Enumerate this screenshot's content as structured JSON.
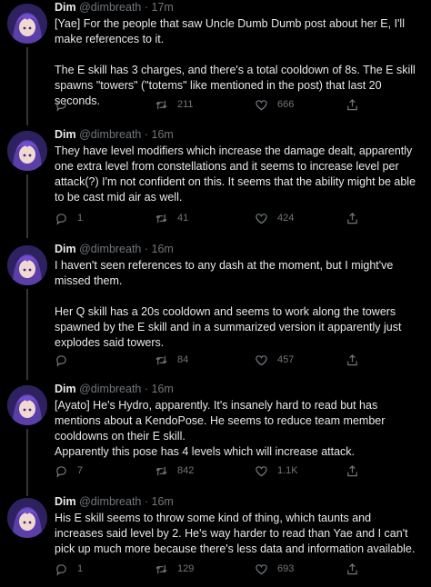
{
  "colors": {
    "background": "#000000",
    "text": "#e7e9ea",
    "muted": "#71767b",
    "line": "#333639"
  },
  "tweets": [
    {
      "name": "Dim",
      "handle": "@dimbreath",
      "dot": "·",
      "time": "17m",
      "text": "[Yae] For the people that saw Uncle Dumb Dumb post about her E, I'll make references to it.\n\nThe E skill has 3 charges, and there's a total cooldown of 8s. The E skill spawns \"towers\" (\"totems\" like mentioned in the post) that last 20 seconds.",
      "replies": "",
      "retweets": "211",
      "likes": "666"
    },
    {
      "name": "Dim",
      "handle": "@dimbreath",
      "dot": "·",
      "time": "16m",
      "text": "They have level modifiers which increase the damage dealt, apparently one extra level from constellations and it seems to increase level per attack(?) I'm not confident on this. It seems that the ability might be able to be cast mid air as well.",
      "replies": "1",
      "retweets": "41",
      "likes": "424"
    },
    {
      "name": "Dim",
      "handle": "@dimbreath",
      "dot": "·",
      "time": "16m",
      "text": "I haven't seen references to any dash at the moment, but I might've missed them.\n\nHer Q skill has a 20s cooldown and seems to work along the towers spawned by the E skill and in a summarized version it apparently just explodes said towers.",
      "replies": "",
      "retweets": "84",
      "likes": "457"
    },
    {
      "name": "Dim",
      "handle": "@dimbreath",
      "dot": "·",
      "time": "16m",
      "text": "[Ayato] He's Hydro, apparently. It's insanely hard to read but has mentions about a KendoPose. He seems to reduce team member cooldowns on their E skill.\nApparently this pose has 4 levels which will increase attack.",
      "replies": "7",
      "retweets": "842",
      "likes": "1.1K"
    },
    {
      "name": "Dim",
      "handle": "@dimbreath",
      "dot": "·",
      "time": "16m",
      "text": "His E skill seems to throw some kind of thing, which taunts and increases said level by 2. He's way harder to read than Yae and I can't pick up much more because there's less data and information available.",
      "replies": "1",
      "retweets": "129",
      "likes": "693"
    }
  ],
  "icons": {
    "reply": "reply-icon",
    "retweet": "retweet-icon",
    "like": "like-icon",
    "share": "share-icon"
  }
}
